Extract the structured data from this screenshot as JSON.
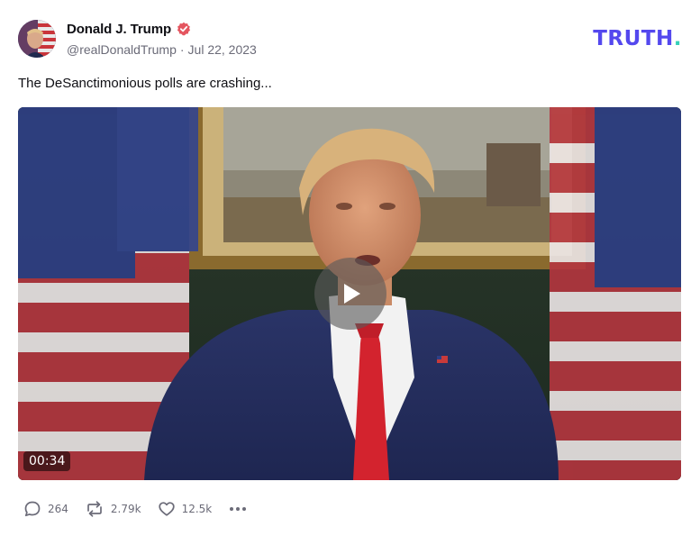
{
  "author": {
    "display_name": "Donald J. Trump",
    "handle": "@realDonaldTrump",
    "separator": "·",
    "date": "Jul 22, 2023",
    "verified": true
  },
  "brand": {
    "wordmark": "TRUTH",
    "dot": ".",
    "color": "#5448ee",
    "dot_color": "#35d0b8"
  },
  "post": {
    "text": "The DeSanctimonious polls are crashing..."
  },
  "video": {
    "duration": "00:34",
    "play_icon": "play-icon"
  },
  "actions": {
    "replies": "264",
    "retruths": "2.79k",
    "likes": "12.5k",
    "reply_icon": "speech-bubble-icon",
    "retruth_icon": "repost-arrows-icon",
    "like_icon": "heart-icon",
    "more_icon": "ellipsis-icon"
  },
  "colors": {
    "verified_badge": "#e4555f",
    "muted_text": "#6b6b78"
  }
}
